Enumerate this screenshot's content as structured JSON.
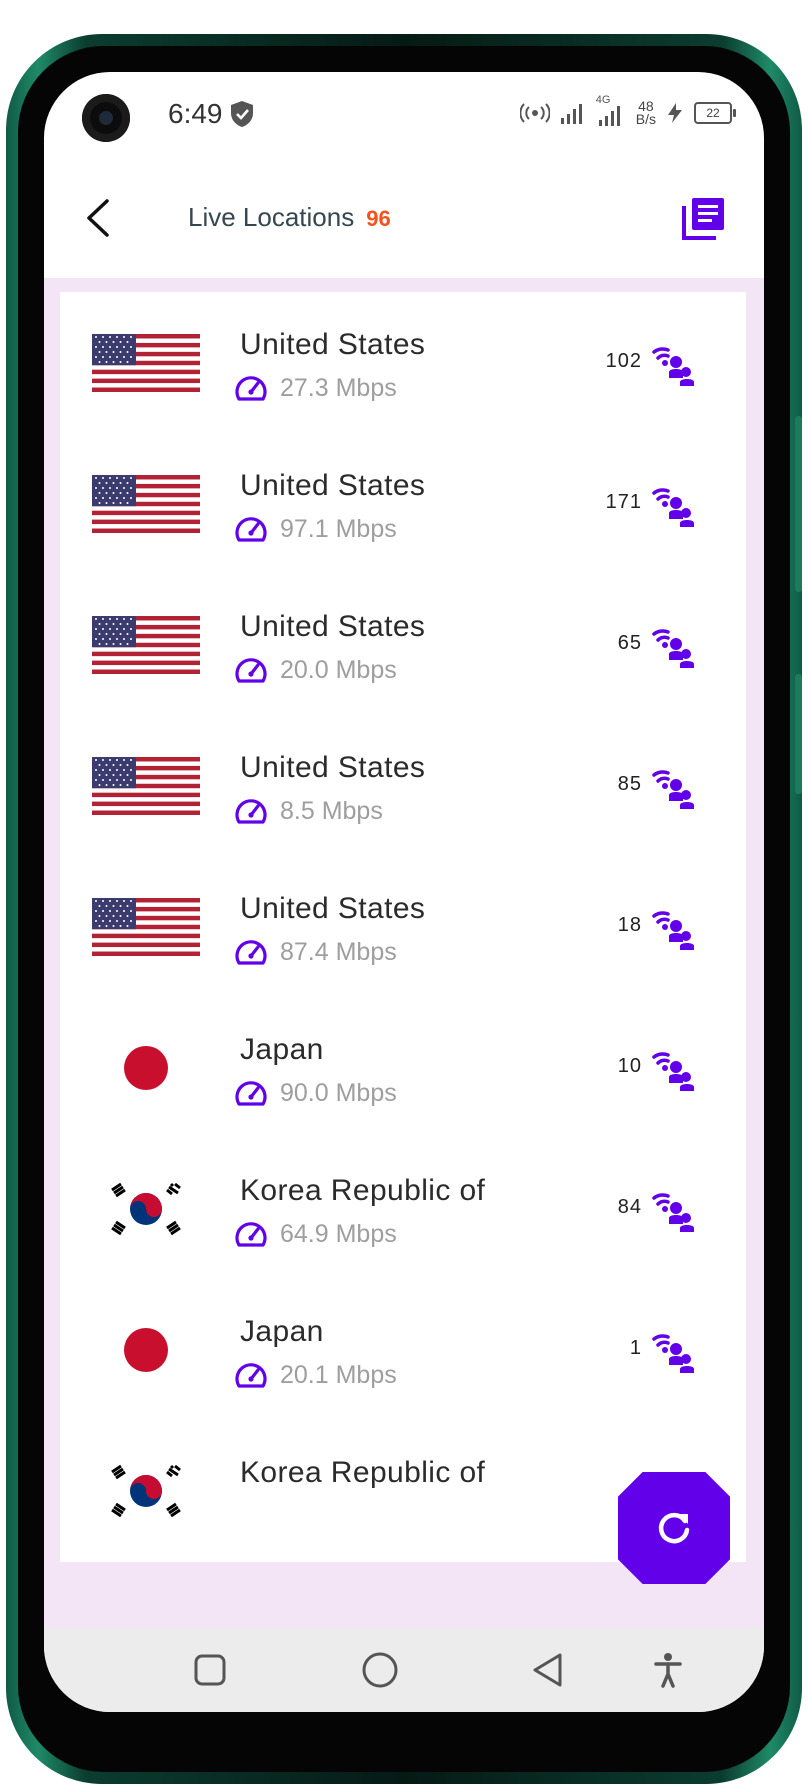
{
  "status_bar": {
    "time": "6:49",
    "network_speed_top": "48",
    "network_speed_unit": "B/s",
    "network_type": "4G",
    "battery": "22"
  },
  "header": {
    "title": "Live Locations",
    "count": "96"
  },
  "colors": {
    "accent": "#6200ea",
    "count": "#f4511e",
    "list_bg": "#f3e5f5"
  },
  "locations": [
    {
      "country": "United States",
      "flag": "us-flag-icon",
      "speed": "27.3 Mbps",
      "users": "102"
    },
    {
      "country": "United States",
      "flag": "us-flag-icon",
      "speed": "97.1 Mbps",
      "users": "171"
    },
    {
      "country": "United States",
      "flag": "us-flag-icon",
      "speed": "20.0 Mbps",
      "users": "65"
    },
    {
      "country": "United States",
      "flag": "us-flag-icon",
      "speed": "8.5 Mbps",
      "users": "85"
    },
    {
      "country": "United States",
      "flag": "us-flag-icon",
      "speed": "87.4 Mbps",
      "users": "18"
    },
    {
      "country": "Japan",
      "flag": "japan-flag-icon",
      "speed": "90.0 Mbps",
      "users": "10"
    },
    {
      "country": "Korea Republic of",
      "flag": "korea-flag-icon",
      "speed": "64.9 Mbps",
      "users": "84"
    },
    {
      "country": "Japan",
      "flag": "japan-flag-icon",
      "speed": "20.1 Mbps",
      "users": "1"
    },
    {
      "country": "Korea Republic of",
      "flag": "korea-flag-icon",
      "speed": "",
      "users": ""
    }
  ]
}
